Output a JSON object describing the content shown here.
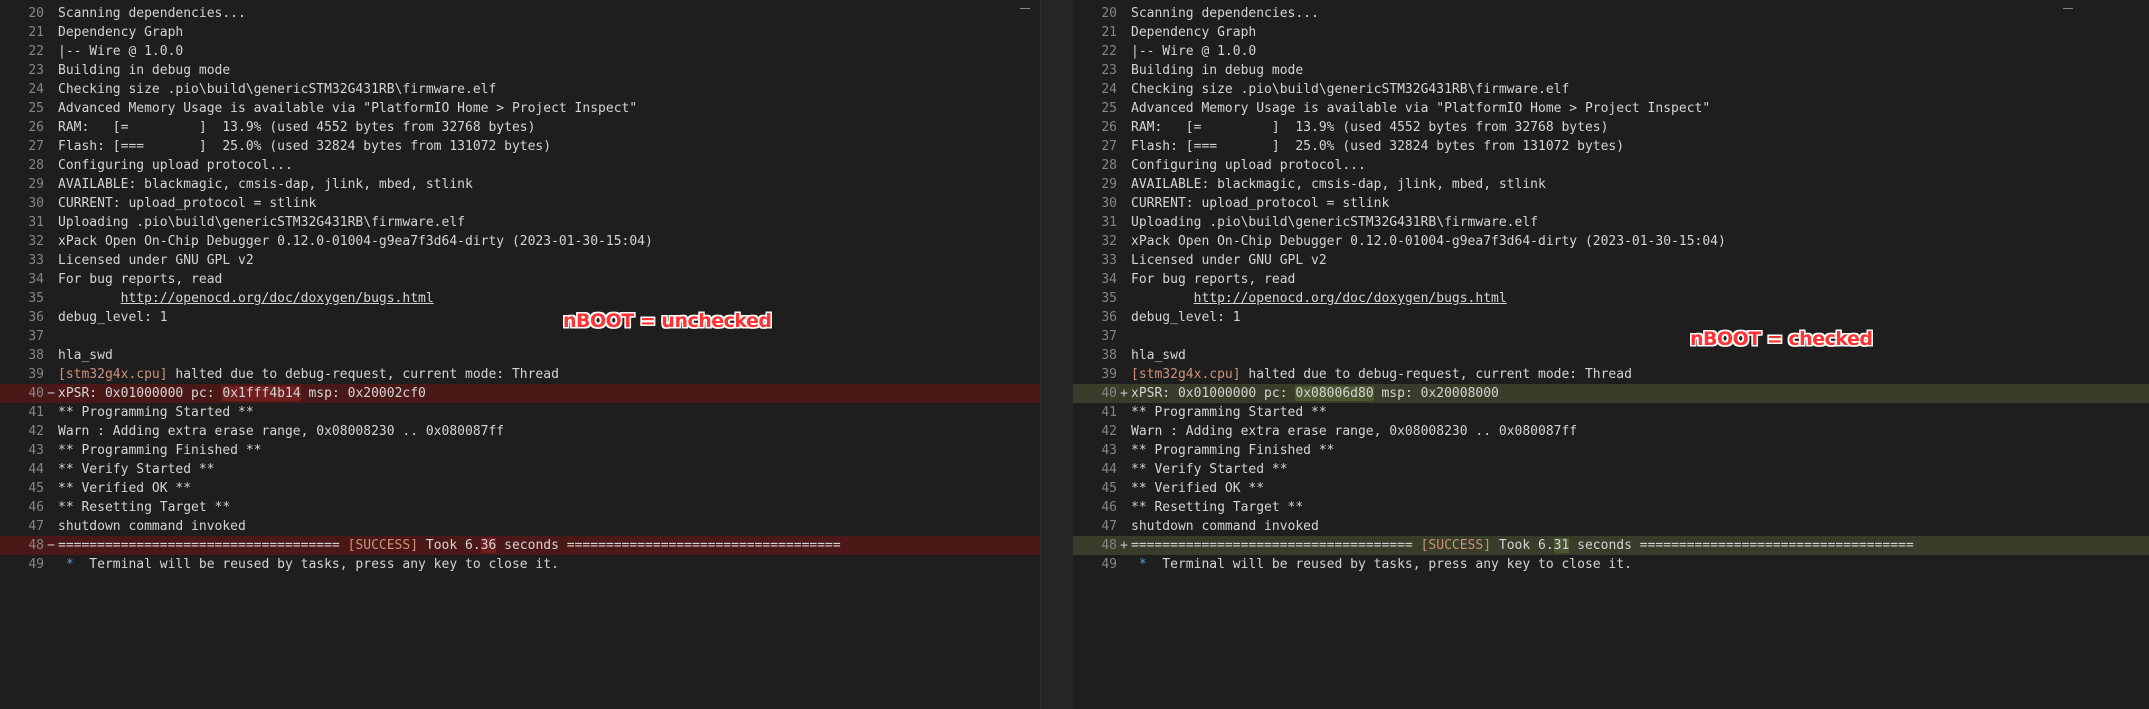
{
  "left": {
    "annotation": "nBOOT = unchecked",
    "line40": {
      "num": "40",
      "gutter": "−",
      "pre": "xPSR: 0x01000000 pc: ",
      "changed": "0x1fff4b14",
      "post": " msp: 0x20002cf0"
    },
    "line48": {
      "num": "48",
      "gutter": "−",
      "pre": "==================================== ",
      "tag": "[SUCCESS]",
      "mid": " Took 6.",
      "changed": "36",
      "post": " seconds ==================================="
    }
  },
  "right": {
    "annotation": "nBOOT = checked",
    "line40": {
      "num": "40",
      "gutter": "+",
      "pre": "xPSR: 0x01000000 pc: ",
      "changed": "0x08006d80",
      "post": " msp: 0x20008000"
    },
    "line48": {
      "num": "48",
      "gutter": "+",
      "pre": "==================================== ",
      "tag": "[SUCCESS]",
      "mid": " Took 6.",
      "changed": "31",
      "post": " seconds ==================================="
    }
  },
  "common": {
    "l20": {
      "num": "20",
      "text": "Scanning dependencies..."
    },
    "l21": {
      "num": "21",
      "text": "Dependency Graph"
    },
    "l22": {
      "num": "22",
      "text": "|-- Wire @ 1.0.0"
    },
    "l23": {
      "num": "23",
      "text": "Building in debug mode"
    },
    "l24": {
      "num": "24",
      "text": "Checking size .pio\\build\\genericSTM32G431RB\\firmware.elf"
    },
    "l25": {
      "num": "25",
      "text": "Advanced Memory Usage is available via \"PlatformIO Home > Project Inspect\""
    },
    "l26": {
      "num": "26",
      "text": "RAM:   [=         ]  13.9% (used 4552 bytes from 32768 bytes)"
    },
    "l27": {
      "num": "27",
      "text": "Flash: [===       ]  25.0% (used 32824 bytes from 131072 bytes)"
    },
    "l28": {
      "num": "28",
      "text": "Configuring upload protocol..."
    },
    "l29": {
      "num": "29",
      "text": "AVAILABLE: blackmagic, cmsis-dap, jlink, mbed, stlink"
    },
    "l30": {
      "num": "30",
      "text": "CURRENT: upload_protocol = stlink"
    },
    "l31": {
      "num": "31",
      "text": "Uploading .pio\\build\\genericSTM32G431RB\\firmware.elf"
    },
    "l32": {
      "num": "32",
      "text": "xPack Open On-Chip Debugger 0.12.0-01004-g9ea7f3d64-dirty (2023-01-30-15:04)"
    },
    "l33": {
      "num": "33",
      "text": "Licensed under GNU GPL v2"
    },
    "l34": {
      "num": "34",
      "text": "For bug reports, read"
    },
    "l35": {
      "num": "35",
      "indent": "        ",
      "link": "http://openocd.org/doc/doxygen/bugs.html"
    },
    "l36": {
      "num": "36",
      "text": "debug_level: 1"
    },
    "l37": {
      "num": "37",
      "text": ""
    },
    "l38": {
      "num": "38",
      "text": "hla_swd"
    },
    "l39": {
      "num": "39",
      "tag": "[stm32g4x.cpu]",
      "text": " halted due to debug-request, current mode: Thread"
    },
    "l41": {
      "num": "41",
      "text": "** Programming Started **"
    },
    "l42": {
      "num": "42",
      "text": "Warn : Adding extra erase range, 0x08008230 .. 0x080087ff"
    },
    "l43": {
      "num": "43",
      "text": "** Programming Finished **"
    },
    "l44": {
      "num": "44",
      "text": "** Verify Started **"
    },
    "l45": {
      "num": "45",
      "text": "** Verified OK **"
    },
    "l46": {
      "num": "46",
      "text": "** Resetting Target **"
    },
    "l47": {
      "num": "47",
      "text": "shutdown command invoked"
    },
    "l49": {
      "num": "49",
      "star": "*",
      "text": "  Terminal will be reused by tasks, press any key to close it."
    }
  }
}
